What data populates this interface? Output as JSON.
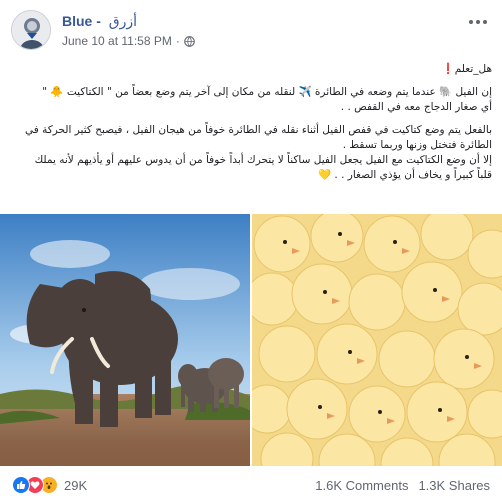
{
  "post": {
    "author_latin": "Blue -",
    "author_arabic": "أزرق",
    "timestamp": "June 10 at 11:58 PM",
    "privacy_icon": "globe-icon",
    "avatar_icon": "avatar-illustration"
  },
  "body": {
    "line1": "هل_تعلم❗",
    "line2": "إن الفيل 🐘 عندما يتم وضعه في الطائرة ✈️ لنقله من مكان إلى آخر يتم وضع بعضاً من \" الكتاكيت 🐥 \"",
    "line3": "أي صغار الدجاج معه في القفص . .",
    "line4": "بالفعل يتم وضع كتاكيت في قفص الفيل أثناء نقله في الطائرة خوفاً من هيجان الفيل ، فيصبح كثير الحركة في",
    "line5": "الطائرة فتختل وزنها وربما تسقط .",
    "line6": "إلا أن وضع الكتاكيت مع الفيل يجعل الفيل ساكناً لا يتحرك أبداً خوفاً من أن يدوس عليهم أو يأذيهم لأنه يملك",
    "line7": "قلباً كبيراً و يخاف أن يؤذي الصغار . . 💛"
  },
  "images": {
    "left": "elephant-photo",
    "right": "chicks-photo"
  },
  "footer": {
    "reaction_icons": [
      "like-icon",
      "love-icon",
      "wow-icon"
    ],
    "reaction_count": "29K",
    "comments": "1.6K Comments",
    "shares": "1.3K Shares"
  },
  "colors": {
    "link": "#385898",
    "meta": "#606770",
    "like": "#1877f2",
    "love": "#f33e58",
    "wow": "#f7b125"
  }
}
